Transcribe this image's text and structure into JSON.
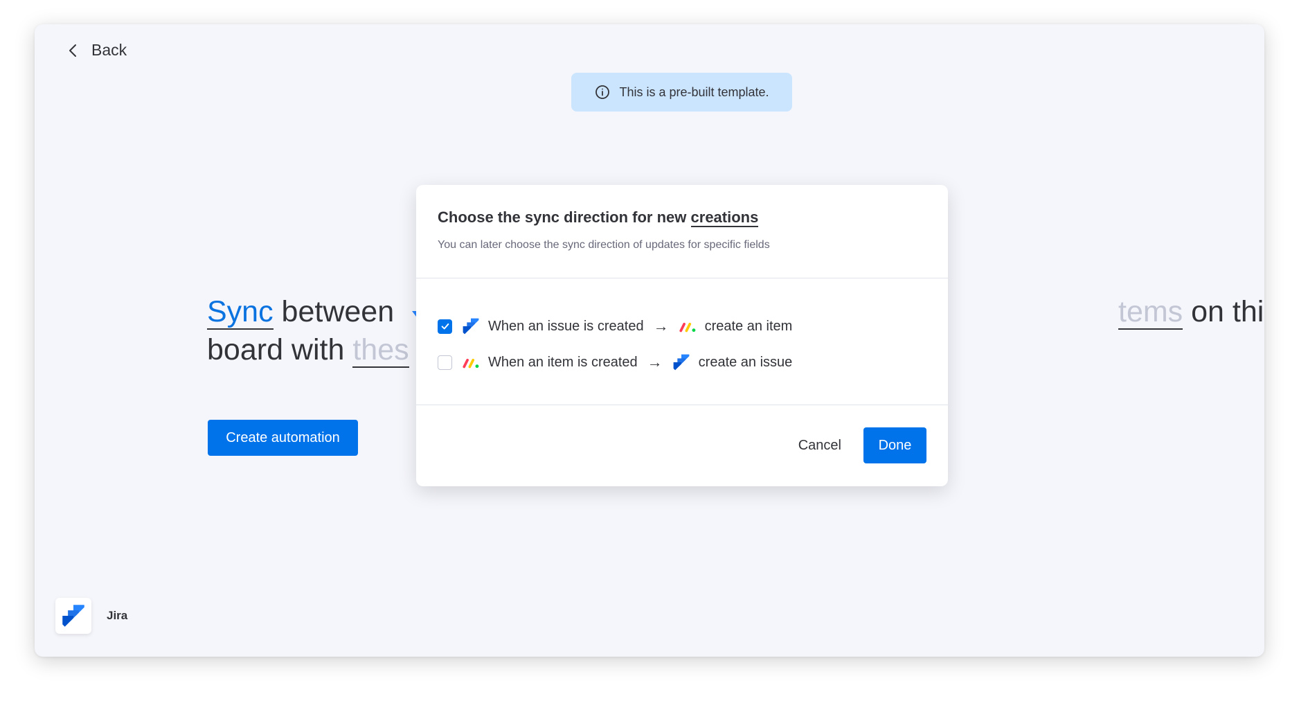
{
  "nav": {
    "back_label": "Back"
  },
  "banner": {
    "text": "This is a pre-built template."
  },
  "sentence": {
    "part_sync": "Sync",
    "part_between": " between ",
    "part_items": "tems",
    "part_on_this": " on this",
    "part_board_with": "board with ",
    "part_these": "thes"
  },
  "actions": {
    "create_automation": "Create automation"
  },
  "footer": {
    "app_name": "Jira"
  },
  "modal": {
    "title_prefix": "Choose the sync direction for new ",
    "title_underlined": "creations",
    "subtitle": "You can later choose the sync direction of updates for specific fields",
    "options": [
      {
        "checked": true,
        "source_icon": "jira-icon",
        "trigger": "When an issue is created",
        "arrow": "→",
        "target_icon": "monday-icon",
        "action": "create an item"
      },
      {
        "checked": false,
        "source_icon": "monday-icon",
        "trigger": "When an item is created",
        "arrow": "→",
        "target_icon": "jira-icon",
        "action": "create an issue"
      }
    ],
    "cancel_label": "Cancel",
    "done_label": "Done"
  },
  "colors": {
    "primary": "#0073ea",
    "banner_bg": "#cce5ff",
    "text": "#323338",
    "muted": "#676879",
    "page_bg": "#f5f6fb"
  }
}
